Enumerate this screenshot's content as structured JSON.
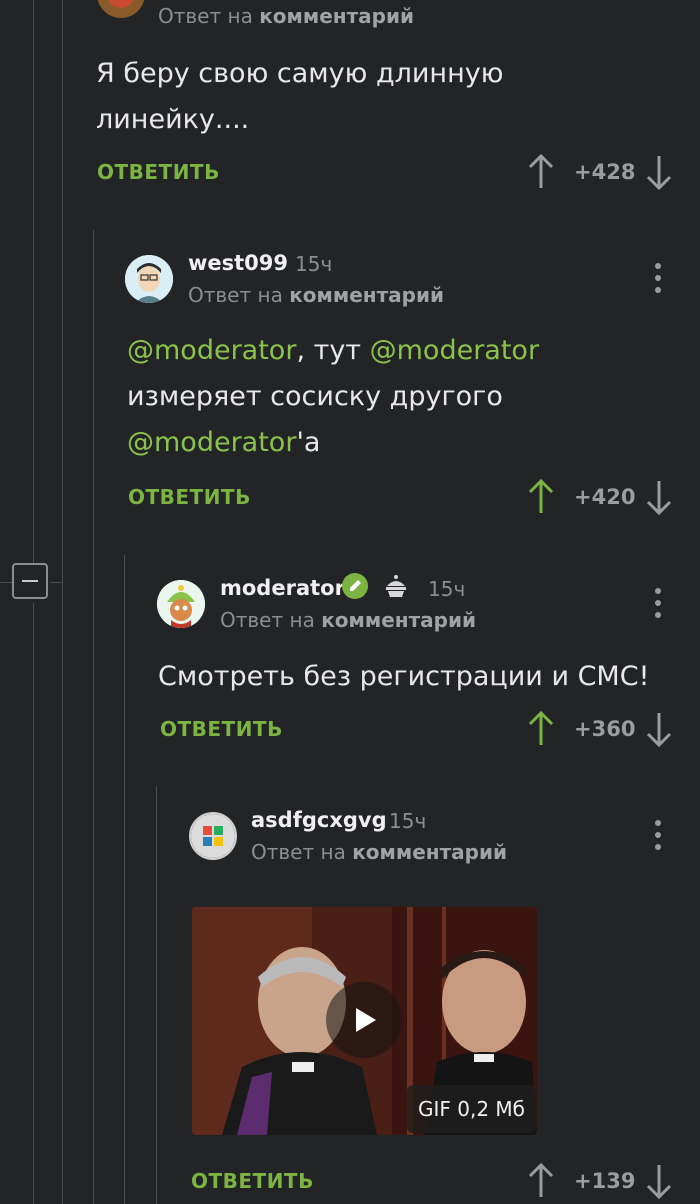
{
  "comments": [
    {
      "reply_prefix": "Ответ на",
      "reply_target": "комментарий",
      "text": "Я беру свою самую длинную линейку....",
      "answer_label": "ОТВЕТИТЬ",
      "score": "+428"
    },
    {
      "author": "west099",
      "time": "15ч",
      "reply_prefix": "Ответ на",
      "reply_target": "комментарий",
      "text_parts": [
        "@moderator",
        ", тут ",
        "@moderator",
        "измеряет сосиску другого",
        "@moderator",
        "'а"
      ],
      "answer_label": "ОТВЕТИТЬ",
      "score": "+420"
    },
    {
      "author": "moderator",
      "time": "15ч",
      "reply_prefix": "Ответ на",
      "reply_target": "комментарий",
      "text": "Смотреть без регистрации и СМС!",
      "answer_label": "ОТВЕТИТЬ",
      "score": "+360"
    },
    {
      "author": "asdfgcxgvg",
      "time": "15ч",
      "reply_prefix": "Ответ на",
      "reply_target": "комментарий",
      "media_badge": "GIF 0,2 Мб",
      "answer_label": "ОТВЕТИТЬ",
      "score": "+139"
    }
  ],
  "colors": {
    "background": "#222426",
    "accent_green": "#7cb342",
    "mention": "#8bc34a",
    "upvote_active": "#7cb342",
    "muted": "#8b8e91"
  },
  "icons": {
    "collapse": "minus-square-icon",
    "upvote": "arrow-up-icon",
    "downvote": "arrow-down-icon",
    "more": "kebab-icon",
    "verified": "pencil-badge-icon",
    "cake": "cake-icon",
    "play": "play-icon"
  }
}
